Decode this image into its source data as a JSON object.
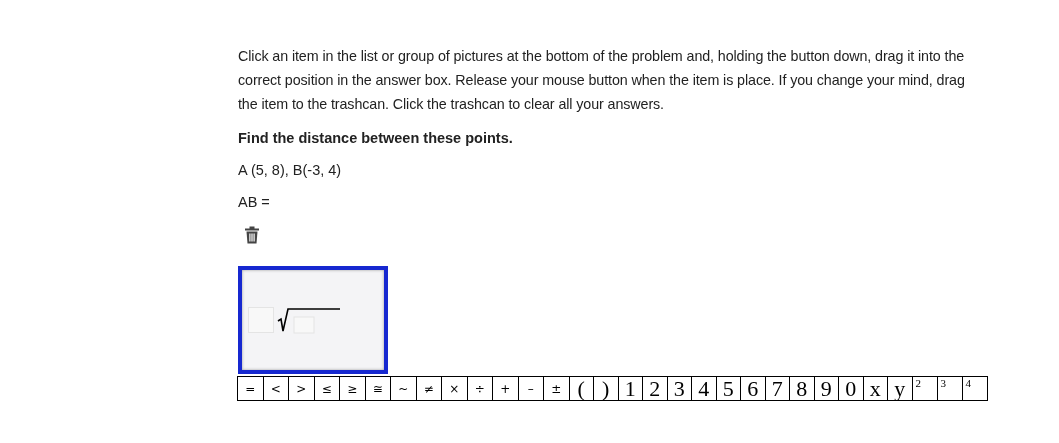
{
  "instructions": {
    "lines": [
      "Click an item in the list or group of pictures at the bottom of the problem and, holding the button down, drag it into the",
      "correct position in the answer box. Release your mouse button when the item is place. If you change your mind, drag",
      "the item to the trashcan. Click the trashcan to clear all your answers."
    ]
  },
  "question": "Find the distance between these points.",
  "points": "A (5, 8), B(-3, 4)",
  "answer_label": "AB =",
  "palette": [
    {
      "kind": "symbol",
      "label": "="
    },
    {
      "kind": "symbol",
      "label": "<"
    },
    {
      "kind": "symbol",
      "label": ">"
    },
    {
      "kind": "symbol",
      "label": "≤"
    },
    {
      "kind": "symbol",
      "label": "≥"
    },
    {
      "kind": "symbol",
      "label": "≅"
    },
    {
      "kind": "symbol",
      "label": "~"
    },
    {
      "kind": "symbol",
      "label": "≠"
    },
    {
      "kind": "symbol",
      "label": "×"
    },
    {
      "kind": "symbol",
      "label": "÷"
    },
    {
      "kind": "symbol",
      "label": "+"
    },
    {
      "kind": "symbol",
      "label": "–"
    },
    {
      "kind": "symbol",
      "label": "±"
    },
    {
      "kind": "glyph",
      "label": "("
    },
    {
      "kind": "glyph",
      "label": ")"
    },
    {
      "kind": "glyph",
      "label": "1"
    },
    {
      "kind": "glyph",
      "label": "2"
    },
    {
      "kind": "glyph",
      "label": "3"
    },
    {
      "kind": "glyph",
      "label": "4"
    },
    {
      "kind": "glyph",
      "label": "5"
    },
    {
      "kind": "glyph",
      "label": "6"
    },
    {
      "kind": "glyph",
      "label": "7"
    },
    {
      "kind": "glyph",
      "label": "8"
    },
    {
      "kind": "glyph",
      "label": "9"
    },
    {
      "kind": "glyph",
      "label": "0"
    },
    {
      "kind": "glyph",
      "label": "x"
    },
    {
      "kind": "glyph",
      "label": "y"
    },
    {
      "kind": "sup",
      "label": "2"
    },
    {
      "kind": "sup",
      "label": "3"
    },
    {
      "kind": "sup",
      "label": "4"
    }
  ]
}
